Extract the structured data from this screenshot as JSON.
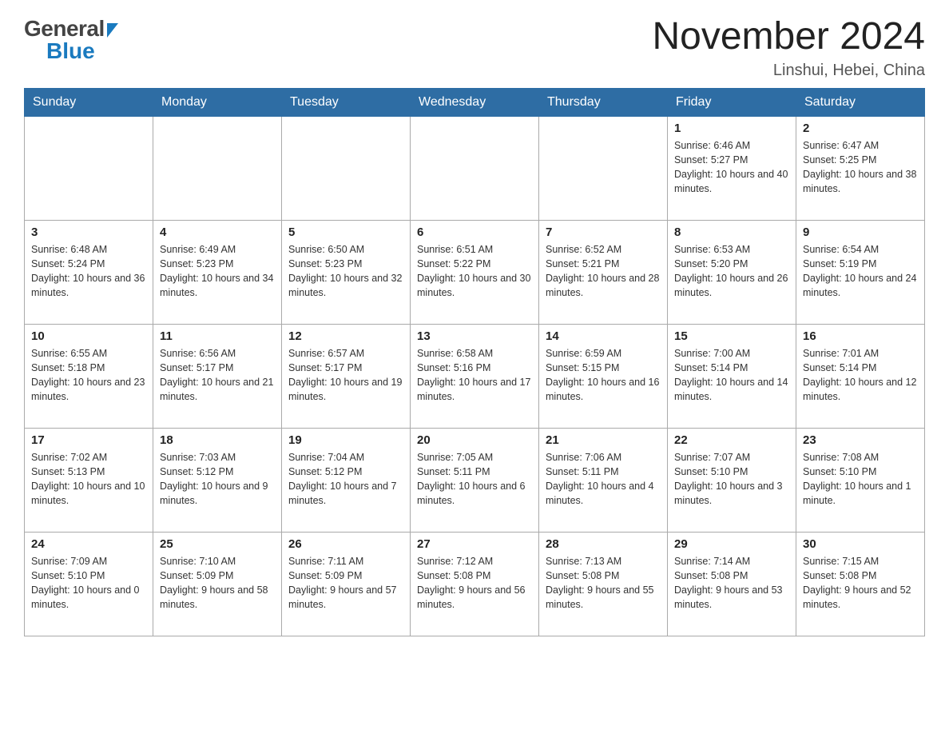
{
  "header": {
    "logo_general": "General",
    "logo_blue": "Blue",
    "month_title": "November 2024",
    "location": "Linshui, Hebei, China"
  },
  "weekdays": [
    "Sunday",
    "Monday",
    "Tuesday",
    "Wednesday",
    "Thursday",
    "Friday",
    "Saturday"
  ],
  "weeks": [
    [
      {
        "day": "",
        "info": ""
      },
      {
        "day": "",
        "info": ""
      },
      {
        "day": "",
        "info": ""
      },
      {
        "day": "",
        "info": ""
      },
      {
        "day": "",
        "info": ""
      },
      {
        "day": "1",
        "info": "Sunrise: 6:46 AM\nSunset: 5:27 PM\nDaylight: 10 hours and 40 minutes."
      },
      {
        "day": "2",
        "info": "Sunrise: 6:47 AM\nSunset: 5:25 PM\nDaylight: 10 hours and 38 minutes."
      }
    ],
    [
      {
        "day": "3",
        "info": "Sunrise: 6:48 AM\nSunset: 5:24 PM\nDaylight: 10 hours and 36 minutes."
      },
      {
        "day": "4",
        "info": "Sunrise: 6:49 AM\nSunset: 5:23 PM\nDaylight: 10 hours and 34 minutes."
      },
      {
        "day": "5",
        "info": "Sunrise: 6:50 AM\nSunset: 5:23 PM\nDaylight: 10 hours and 32 minutes."
      },
      {
        "day": "6",
        "info": "Sunrise: 6:51 AM\nSunset: 5:22 PM\nDaylight: 10 hours and 30 minutes."
      },
      {
        "day": "7",
        "info": "Sunrise: 6:52 AM\nSunset: 5:21 PM\nDaylight: 10 hours and 28 minutes."
      },
      {
        "day": "8",
        "info": "Sunrise: 6:53 AM\nSunset: 5:20 PM\nDaylight: 10 hours and 26 minutes."
      },
      {
        "day": "9",
        "info": "Sunrise: 6:54 AM\nSunset: 5:19 PM\nDaylight: 10 hours and 24 minutes."
      }
    ],
    [
      {
        "day": "10",
        "info": "Sunrise: 6:55 AM\nSunset: 5:18 PM\nDaylight: 10 hours and 23 minutes."
      },
      {
        "day": "11",
        "info": "Sunrise: 6:56 AM\nSunset: 5:17 PM\nDaylight: 10 hours and 21 minutes."
      },
      {
        "day": "12",
        "info": "Sunrise: 6:57 AM\nSunset: 5:17 PM\nDaylight: 10 hours and 19 minutes."
      },
      {
        "day": "13",
        "info": "Sunrise: 6:58 AM\nSunset: 5:16 PM\nDaylight: 10 hours and 17 minutes."
      },
      {
        "day": "14",
        "info": "Sunrise: 6:59 AM\nSunset: 5:15 PM\nDaylight: 10 hours and 16 minutes."
      },
      {
        "day": "15",
        "info": "Sunrise: 7:00 AM\nSunset: 5:14 PM\nDaylight: 10 hours and 14 minutes."
      },
      {
        "day": "16",
        "info": "Sunrise: 7:01 AM\nSunset: 5:14 PM\nDaylight: 10 hours and 12 minutes."
      }
    ],
    [
      {
        "day": "17",
        "info": "Sunrise: 7:02 AM\nSunset: 5:13 PM\nDaylight: 10 hours and 10 minutes."
      },
      {
        "day": "18",
        "info": "Sunrise: 7:03 AM\nSunset: 5:12 PM\nDaylight: 10 hours and 9 minutes."
      },
      {
        "day": "19",
        "info": "Sunrise: 7:04 AM\nSunset: 5:12 PM\nDaylight: 10 hours and 7 minutes."
      },
      {
        "day": "20",
        "info": "Sunrise: 7:05 AM\nSunset: 5:11 PM\nDaylight: 10 hours and 6 minutes."
      },
      {
        "day": "21",
        "info": "Sunrise: 7:06 AM\nSunset: 5:11 PM\nDaylight: 10 hours and 4 minutes."
      },
      {
        "day": "22",
        "info": "Sunrise: 7:07 AM\nSunset: 5:10 PM\nDaylight: 10 hours and 3 minutes."
      },
      {
        "day": "23",
        "info": "Sunrise: 7:08 AM\nSunset: 5:10 PM\nDaylight: 10 hours and 1 minute."
      }
    ],
    [
      {
        "day": "24",
        "info": "Sunrise: 7:09 AM\nSunset: 5:10 PM\nDaylight: 10 hours and 0 minutes."
      },
      {
        "day": "25",
        "info": "Sunrise: 7:10 AM\nSunset: 5:09 PM\nDaylight: 9 hours and 58 minutes."
      },
      {
        "day": "26",
        "info": "Sunrise: 7:11 AM\nSunset: 5:09 PM\nDaylight: 9 hours and 57 minutes."
      },
      {
        "day": "27",
        "info": "Sunrise: 7:12 AM\nSunset: 5:08 PM\nDaylight: 9 hours and 56 minutes."
      },
      {
        "day": "28",
        "info": "Sunrise: 7:13 AM\nSunset: 5:08 PM\nDaylight: 9 hours and 55 minutes."
      },
      {
        "day": "29",
        "info": "Sunrise: 7:14 AM\nSunset: 5:08 PM\nDaylight: 9 hours and 53 minutes."
      },
      {
        "day": "30",
        "info": "Sunrise: 7:15 AM\nSunset: 5:08 PM\nDaylight: 9 hours and 52 minutes."
      }
    ]
  ]
}
